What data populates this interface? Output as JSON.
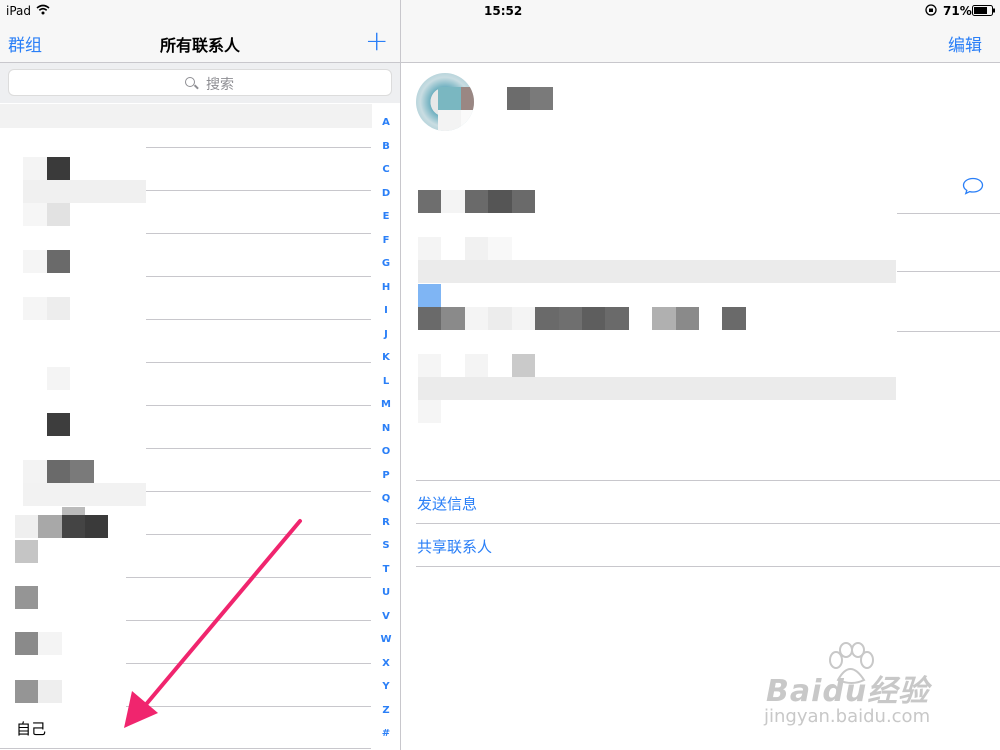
{
  "status_bar": {
    "device": "iPad",
    "time": "15:52",
    "battery": "71%",
    "icons": [
      "wifi-icon",
      "orientation-lock-icon",
      "battery-icon"
    ]
  },
  "left_nav": {
    "groups_label": "群组",
    "title": "所有联系人",
    "add_label": "+"
  },
  "search": {
    "placeholder": "搜索"
  },
  "index_letters": [
    "A",
    "B",
    "C",
    "D",
    "E",
    "F",
    "G",
    "H",
    "I",
    "J",
    "K",
    "L",
    "M",
    "N",
    "O",
    "P",
    "Q",
    "R",
    "S",
    "T",
    "U",
    "V",
    "W",
    "X",
    "Y",
    "Z",
    "#"
  ],
  "contacts": {
    "last_label": "自己"
  },
  "right_nav": {
    "edit_label": "编辑"
  },
  "detail": {
    "send_message_label": "发送信息",
    "share_contact_label": "共享联系人",
    "message_icon": "speech-bubble-icon"
  },
  "watermark": {
    "brand": "Baidu经验",
    "url": "jingyan.baidu.com"
  },
  "colors": {
    "accent": "#2a7ff7",
    "arrow": "#f0256e",
    "separator": "#c8c7cc"
  }
}
